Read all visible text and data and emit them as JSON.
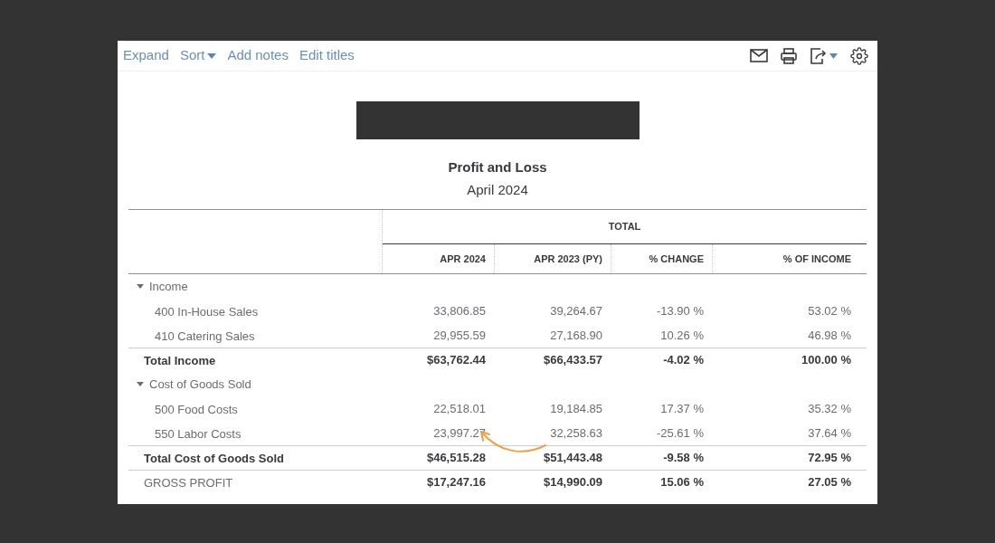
{
  "toolbar": {
    "links": [
      {
        "label": "Expand",
        "kind": "link"
      },
      {
        "label": "Sort",
        "kind": "menu"
      },
      {
        "label": "Add notes",
        "kind": "link"
      },
      {
        "label": "Edit titles",
        "kind": "link"
      }
    ]
  },
  "report": {
    "title": "Profit and Loss",
    "period": "April 2024"
  },
  "table": {
    "group_heading": "TOTAL",
    "columns": [
      "APR 2024",
      "APR 2023 (PY)",
      "% CHANGE",
      "% OF INCOME"
    ],
    "rows": [
      {
        "kind": "group",
        "label": "Income",
        "expanded": true
      },
      {
        "kind": "item",
        "label": "400 In-House Sales",
        "values": [
          "33,806.85",
          "39,264.67",
          "-13.90 %",
          "53.02 %"
        ]
      },
      {
        "kind": "item",
        "label": "410 Catering Sales",
        "values": [
          "29,955.59",
          "27,168.90",
          "10.26 %",
          "46.98 %"
        ]
      },
      {
        "kind": "total",
        "label": "Total Income",
        "values": [
          "$63,762.44",
          "$66,433.57",
          "-4.02 %",
          "100.00 %"
        ]
      },
      {
        "kind": "group",
        "label": "Cost of Goods Sold",
        "expanded": true
      },
      {
        "kind": "item",
        "label": "500 Food Costs",
        "values": [
          "22,518.01",
          "19,184.85",
          "17.37 %",
          "35.32 %"
        ]
      },
      {
        "kind": "item",
        "label": "550 Labor Costs",
        "values": [
          "23,997.27",
          "32,258.63",
          "-25.61 %",
          "37.64 %"
        ]
      },
      {
        "kind": "total",
        "label": "Total Cost of Goods Sold",
        "values": [
          "$46,515.28",
          "$51,443.48",
          "-9.58 %",
          "72.95 %"
        ]
      },
      {
        "kind": "summary",
        "label": "GROSS PROFIT",
        "values": [
          "$17,247.16",
          "$14,990.09",
          "15.06 %",
          "27.05 %"
        ]
      }
    ]
  }
}
